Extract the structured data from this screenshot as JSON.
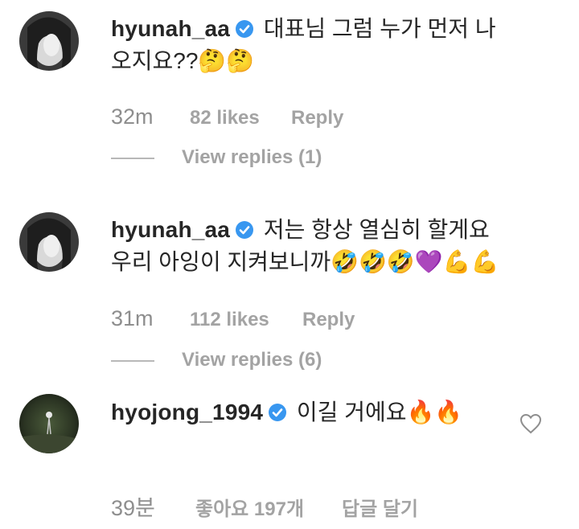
{
  "comments": [
    {
      "username": "hyunah_aa",
      "text": "대표님 그럼 누가 먼저 나오지요??🤔🤔",
      "time": "32m",
      "likes": "82 likes",
      "reply": "Reply",
      "view_replies": "View replies (1)",
      "avatar_icon": "avatar-photo"
    },
    {
      "username": "hyunah_aa",
      "text": "저는 항상 열심히 할게요 우리 아잉이 지켜보니까🤣🤣🤣💜💪💪",
      "time": "31m",
      "likes": "112 likes",
      "reply": "Reply",
      "view_replies": "View replies (6)",
      "avatar_icon": "avatar-photo"
    },
    {
      "username": "hyojong_1994",
      "text": "이길 거에요🔥🔥",
      "time": "39분",
      "likes": "좋아요 197개",
      "reply": "답글 달기",
      "avatar_icon": "avatar-photo"
    }
  ],
  "colors": {
    "verified": "#3897f0",
    "meta_text": "#a3a3a3"
  }
}
